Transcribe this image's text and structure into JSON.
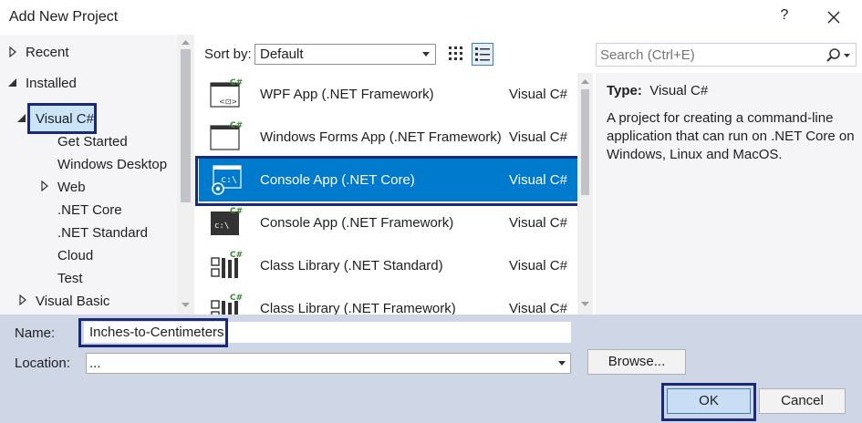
{
  "window": {
    "title": "Add New Project",
    "help": "?"
  },
  "tree": {
    "items": [
      {
        "label": "Recent",
        "arrow": "right"
      },
      {
        "label": "Installed",
        "arrow": "down"
      },
      {
        "label": "Visual C#",
        "arrow": "down-filled",
        "selected": true
      },
      {
        "label": "Get Started"
      },
      {
        "label": "Windows Desktop"
      },
      {
        "label": "Web",
        "arrow": "right"
      },
      {
        "label": ".NET Core"
      },
      {
        "label": ".NET Standard"
      },
      {
        "label": "Cloud"
      },
      {
        "label": "Test"
      },
      {
        "label": "Visual Basic",
        "arrow": "right"
      }
    ]
  },
  "toolbar": {
    "sort_label": "Sort by:",
    "sort_value": "Default",
    "search_placeholder": "Search (Ctrl+E)"
  },
  "templates": [
    {
      "name": "WPF App (.NET Framework)",
      "lang": "Visual C#",
      "icon": "wpf-app-icon"
    },
    {
      "name": "Windows Forms App (.NET Framework)",
      "lang": "Visual C#",
      "icon": "winforms-app-icon"
    },
    {
      "name": "Console App (.NET Core)",
      "lang": "Visual C#",
      "icon": "console-core-icon",
      "selected": true
    },
    {
      "name": "Console App (.NET Framework)",
      "lang": "Visual C#",
      "icon": "console-framework-icon"
    },
    {
      "name": "Class Library (.NET Standard)",
      "lang": "Visual C#",
      "icon": "class-library-icon"
    },
    {
      "name": "Class Library (.NET Framework)",
      "lang": "Visual C#",
      "icon": "class-library-icon"
    }
  ],
  "description": {
    "type_label": "Type:",
    "type_value": "Visual C#",
    "text": "A project for creating a command-line application that can run on .NET Core on Windows, Linux and MacOS."
  },
  "form": {
    "name_label": "Name:",
    "name_value": "Inches-to-Centimeters",
    "location_label": "Location:",
    "location_value": "...",
    "browse_label": "Browse...",
    "ok_label": "OK",
    "cancel_label": "Cancel"
  },
  "colors": {
    "accent": "#007acc",
    "highlight_box": "#1b2a78",
    "bottom_bar": "#cfd6e5"
  }
}
